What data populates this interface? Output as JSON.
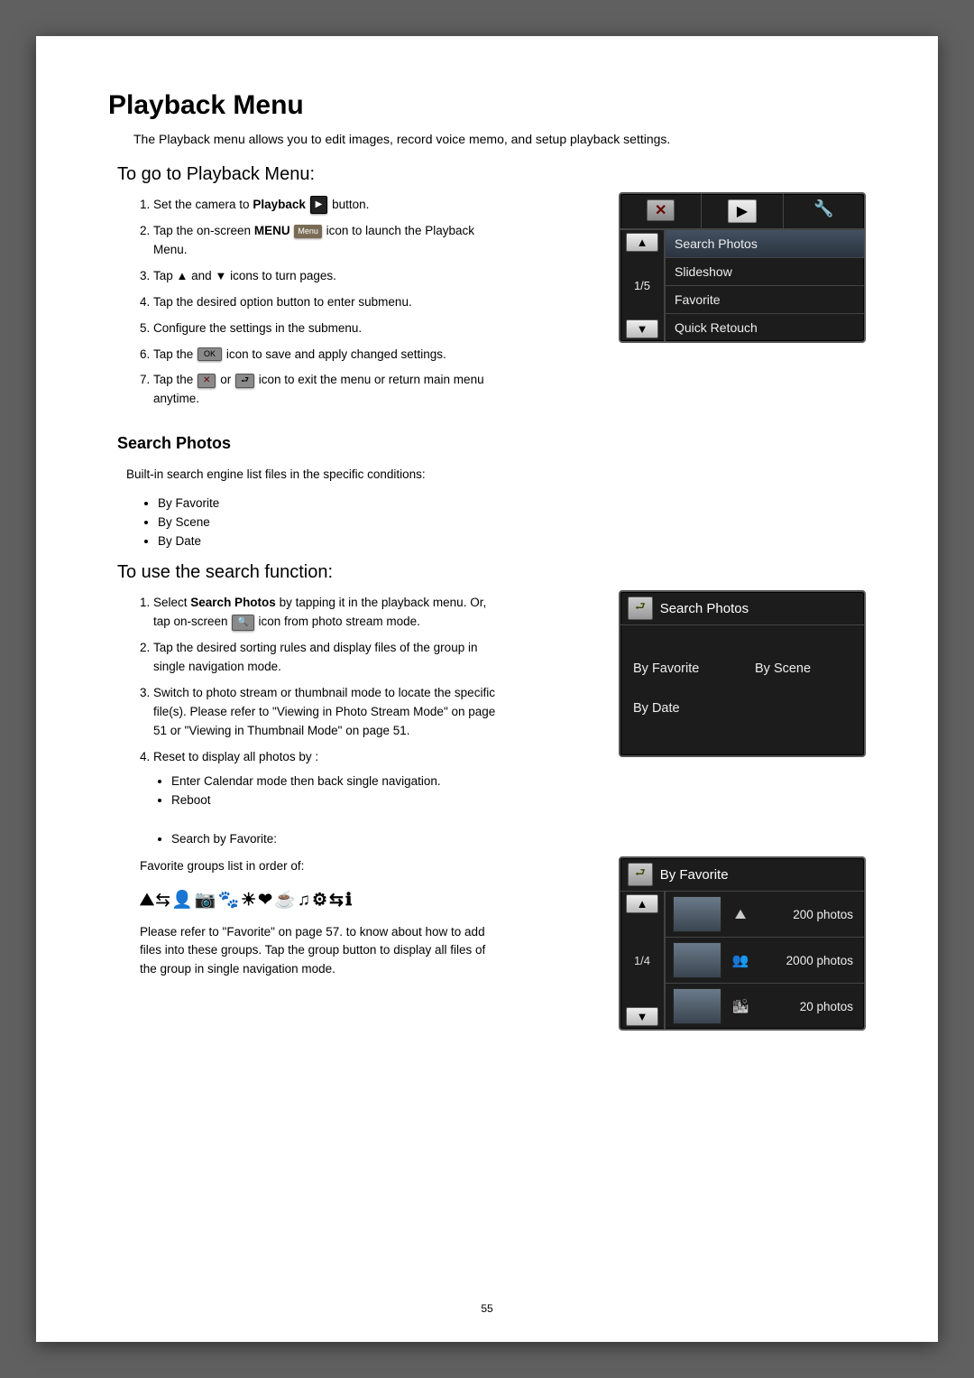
{
  "page_number": "55",
  "title": "Playback Menu",
  "intro": "The Playback menu allows you to edit images, record voice memo, and setup playback settings.",
  "goto_heading": "To go to Playback Menu:",
  "inline": {
    "playback_word": "Playback",
    "menu_word": "MENU",
    "search_photos_bold": "Search Photos"
  },
  "goto_steps": {
    "s1a": "Set the camera to ",
    "s1b": " button.",
    "s2a": "Tap the on-screen ",
    "s2b": " icon to launch the Playback Menu.",
    "s3a": "Tap ",
    "s3b": " and ",
    "s3c": " icons to turn pages.",
    "s4": "Tap the desired option button to enter submenu.",
    "s5": "Configure the settings in the submenu.",
    "s6a": "Tap the ",
    "s6b": " icon to save and apply changed settings.",
    "s7a": "Tap the ",
    "s7b": " or ",
    "s7c": " icon to exit the menu or return main menu anytime."
  },
  "screen1": {
    "page_indicator": "1/5",
    "items": [
      "Search Photos",
      "Slideshow",
      "Favorite",
      "Quick Retouch"
    ]
  },
  "search_heading": "Search Photos",
  "search_intro": "Built-in search engine list files in the specific conditions:",
  "search_list": [
    "By Favorite",
    "By Scene",
    "By Date"
  ],
  "use_heading": "To use the search function:",
  "use_steps": {
    "s1a": "Select ",
    "s1b": " by tapping it in the playback menu. Or, tap on-screen ",
    "s1c": " icon from photo stream mode.",
    "s2": "Tap the desired sorting rules and display files of the group in single navigation mode.",
    "s3": "Switch to photo stream or thumbnail mode to locate the specific file(s).  Please refer to \"Viewing in Photo Stream Mode\" on page 51 or \"Viewing in Thumbnail Mode\" on page 51.",
    "s4": "Reset to display all photos by :"
  },
  "reset_list": [
    "Enter Calendar mode then back single navigation.",
    "Reboot"
  ],
  "fav_bullet": "Search by Favorite:",
  "fav_intro": "Favorite groups list in order of:",
  "icon_strip": "⛰⇆👤📷🐾☀❤☕♫⚙⇆ℹ",
  "fav_after": "Please refer to \"Favorite\" on page 57. to know about how to add files into these groups.  Tap the group button to display all files of the group in single navigation mode.",
  "screen2": {
    "title": "Search Photos",
    "options": [
      "By Favorite",
      "By Scene",
      "By Date"
    ]
  },
  "screen3": {
    "title": "By Favorite",
    "page_indicator": "1/4",
    "rows": [
      {
        "count": "200 photos"
      },
      {
        "count": "2000 photos"
      },
      {
        "count": "20 photos"
      }
    ]
  }
}
